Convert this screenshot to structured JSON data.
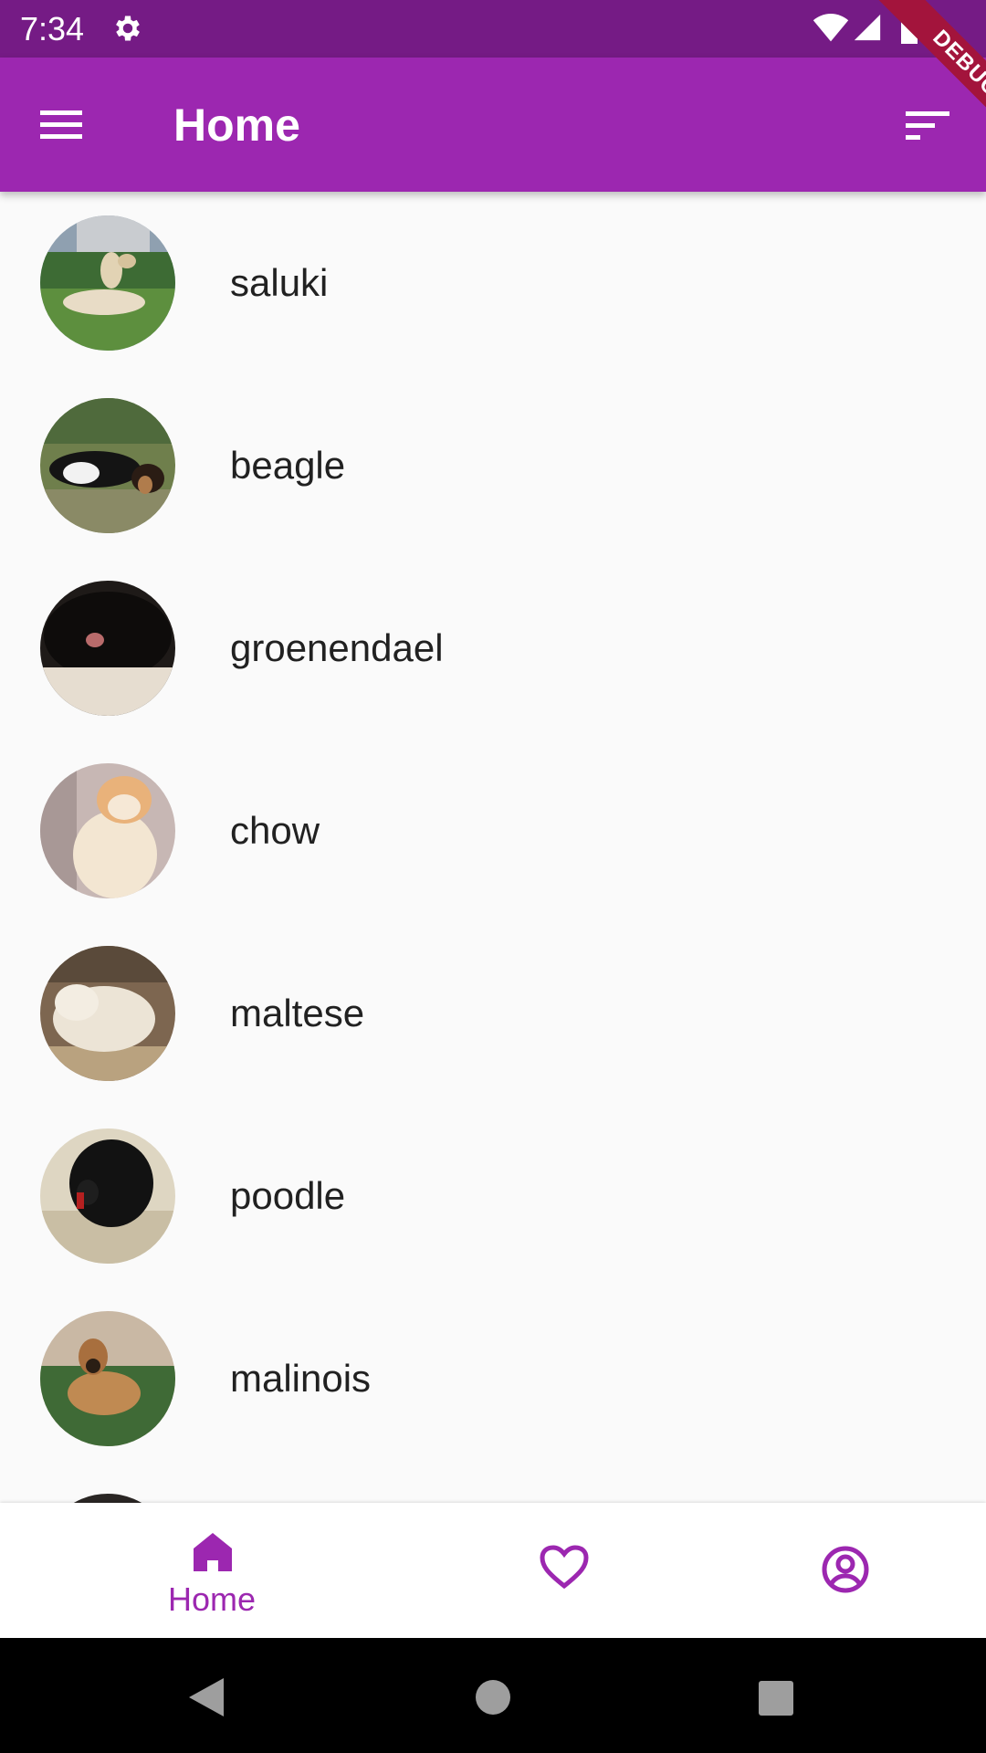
{
  "status_bar": {
    "time": "7:34",
    "icons": [
      "gear-icon",
      "wifi-icon",
      "cell-signal-icon",
      "battery-icon"
    ]
  },
  "app_bar": {
    "title": "Home",
    "menu_icon": "menu-icon",
    "sort_icon": "sort-icon",
    "background": "#9c27b0"
  },
  "debug_banner": {
    "label": "DEBUG"
  },
  "breeds": [
    {
      "label": "saluki",
      "icon": "dog-photo"
    },
    {
      "label": "beagle",
      "icon": "dog-photo"
    },
    {
      "label": "groenendael",
      "icon": "dog-photo"
    },
    {
      "label": "chow",
      "icon": "dog-photo"
    },
    {
      "label": "maltese",
      "icon": "dog-photo"
    },
    {
      "label": "poodle",
      "icon": "dog-photo"
    },
    {
      "label": "malinois",
      "icon": "dog-photo"
    }
  ],
  "bottom_nav": {
    "home_label": "Home",
    "items": [
      "home-icon",
      "heart-icon",
      "account-circle-icon"
    ],
    "active_color": "#9c27b0"
  },
  "system_nav": {
    "items": [
      "back-icon",
      "home-circle-icon",
      "recents-icon"
    ]
  }
}
